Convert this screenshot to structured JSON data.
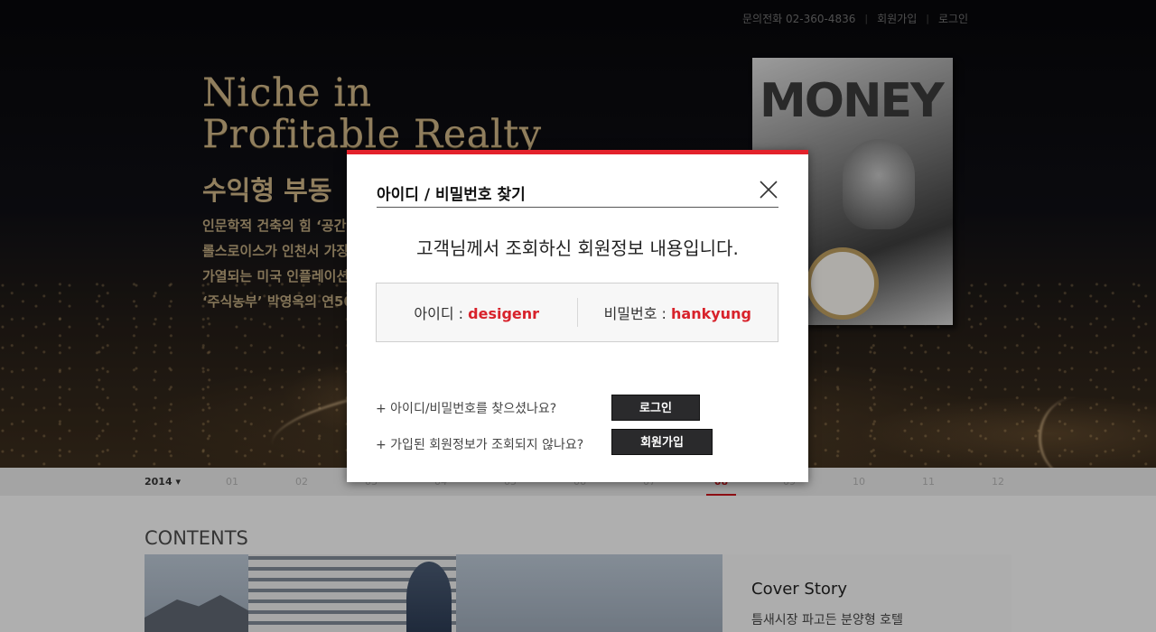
{
  "utility": {
    "phone": "문의전화 02-360-4836",
    "join": "회원가입",
    "login": "로그인"
  },
  "hero": {
    "title": "Niche in\nProfitable Realty",
    "subtitle": "수익형 부동",
    "lines": [
      "인문학적 건축의 힘 ‘공간",
      "롤스로이스가 인천서 가장",
      "가열되는 미국 인플레이션",
      "‘주식농부’ 박영옥의 연50"
    ],
    "magazine_masthead": "MONEY"
  },
  "month_bar": {
    "year": "2014 ▾",
    "months": [
      "01",
      "02",
      "03",
      "04",
      "05",
      "06",
      "07",
      "08",
      "09",
      "10",
      "11",
      "12"
    ],
    "active_index": 7
  },
  "contents": {
    "title": "CONTENTS",
    "cover_story_label": "Cover Story",
    "cover_story_desc": "틈새시장 파고든 분양형 호텔"
  },
  "modal": {
    "title": "아이디 / 비밀번호 찾기",
    "message": "고객님께서 조회하신 회원정보 내용입니다.",
    "id_label": "아이디 : ",
    "id_value": "desigenr",
    "pw_label": "비밀번호 : ",
    "pw_value": "hankyung",
    "found_question": "+ 아이디/비밀번호를 찾으셨나요?",
    "login_button": "로그인",
    "not_found_question": "+ 가입된 회원정보가 조회되지 않나요?",
    "join_button": "회원가입"
  },
  "colors": {
    "accent_red": "#e3222b",
    "value_red": "#d8222b",
    "button_dark": "#2a2a2c"
  }
}
